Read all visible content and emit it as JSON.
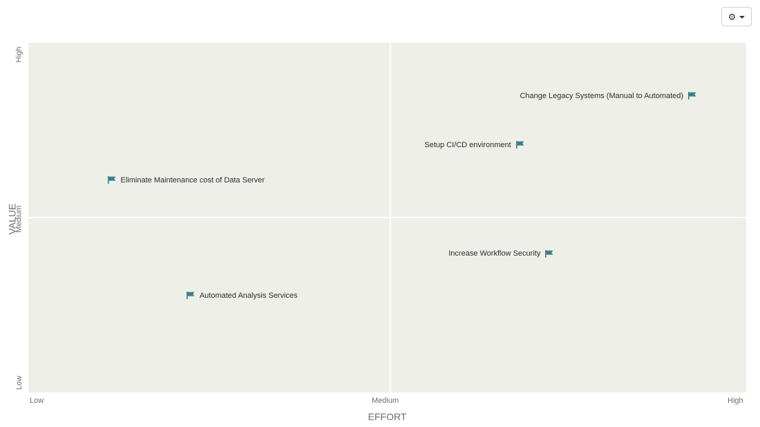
{
  "toolbar": {
    "settings_icon": "gear-icon",
    "dropdown_icon": "caret-down-icon"
  },
  "chart_data": {
    "type": "scatter",
    "xlabel": "EFFORT",
    "ylabel": "VALUE",
    "x_ticks": [
      "Low",
      "Medium",
      "High"
    ],
    "y_ticks": [
      "Low",
      "Medium",
      "High"
    ],
    "xlim": [
      0,
      100
    ],
    "ylim": [
      0,
      100
    ],
    "quadrant_split": {
      "x": 50,
      "y": 50
    },
    "grid": false,
    "colors": {
      "background": "#efefea",
      "divider": "#ffffff",
      "marker": "#3b7f86"
    },
    "marker_icon": "flag-icon",
    "points": [
      {
        "label": "Change Legacy Systems (Manual to Automated)",
        "x": 92.5,
        "y": 84.8,
        "label_side": "left"
      },
      {
        "label": "Setup CI/CD environment",
        "x": 68.5,
        "y": 70.8,
        "label_side": "left"
      },
      {
        "label": "Eliminate Maintenance cost of Data Server",
        "x": 11.6,
        "y": 60.7,
        "label_side": "right"
      },
      {
        "label": "Increase Workflow Security",
        "x": 72.6,
        "y": 39.7,
        "label_side": "left"
      },
      {
        "label": "Automated Analysis Services",
        "x": 22.6,
        "y": 27.7,
        "label_side": "right"
      }
    ]
  }
}
